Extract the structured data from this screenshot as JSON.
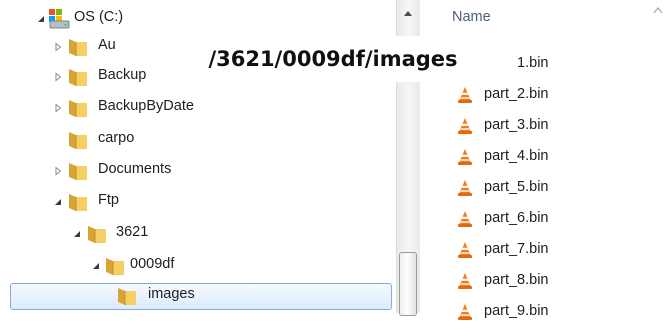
{
  "tree": {
    "items": [
      {
        "label": "OS (C:)",
        "icon": "drive-icon",
        "expanded": true
      },
      {
        "label": "Au",
        "icon": "folder-icon",
        "expanded": false
      },
      {
        "label": "Backup",
        "icon": "folder-icon",
        "expanded": false
      },
      {
        "label": "BackupByDate",
        "icon": "folder-icon",
        "expanded": false
      },
      {
        "label": "carpo",
        "icon": "folder-icon",
        "expanded": null
      },
      {
        "label": "Documents",
        "icon": "folder-icon",
        "expanded": false
      },
      {
        "label": "Ftp",
        "icon": "folder-icon",
        "expanded": true
      },
      {
        "label": "3621",
        "icon": "folder-icon",
        "expanded": true
      },
      {
        "label": "0009df",
        "icon": "folder-icon",
        "expanded": true
      },
      {
        "label": "images",
        "icon": "folder-icon",
        "selected": true
      }
    ]
  },
  "file_list": {
    "column_header": "Name",
    "files": [
      {
        "name": "part_1.bin",
        "icon": "vlc-cone-icon"
      },
      {
        "name": "part_2.bin",
        "icon": "vlc-cone-icon"
      },
      {
        "name": "part_3.bin",
        "icon": "vlc-cone-icon"
      },
      {
        "name": "part_4.bin",
        "icon": "vlc-cone-icon"
      },
      {
        "name": "part_5.bin",
        "icon": "vlc-cone-icon"
      },
      {
        "name": "part_6.bin",
        "icon": "vlc-cone-icon"
      },
      {
        "name": "part_7.bin",
        "icon": "vlc-cone-icon"
      },
      {
        "name": "part_8.bin",
        "icon": "vlc-cone-icon"
      },
      {
        "name": "part_9.bin",
        "icon": "vlc-cone-icon"
      }
    ]
  },
  "overlay_path": "/3621/0009df/images",
  "colors": {
    "folder": "#e8b84a",
    "selection_border": "#84acdd",
    "cone_orange": "#f07d1a",
    "header_text": "#4c607a"
  }
}
